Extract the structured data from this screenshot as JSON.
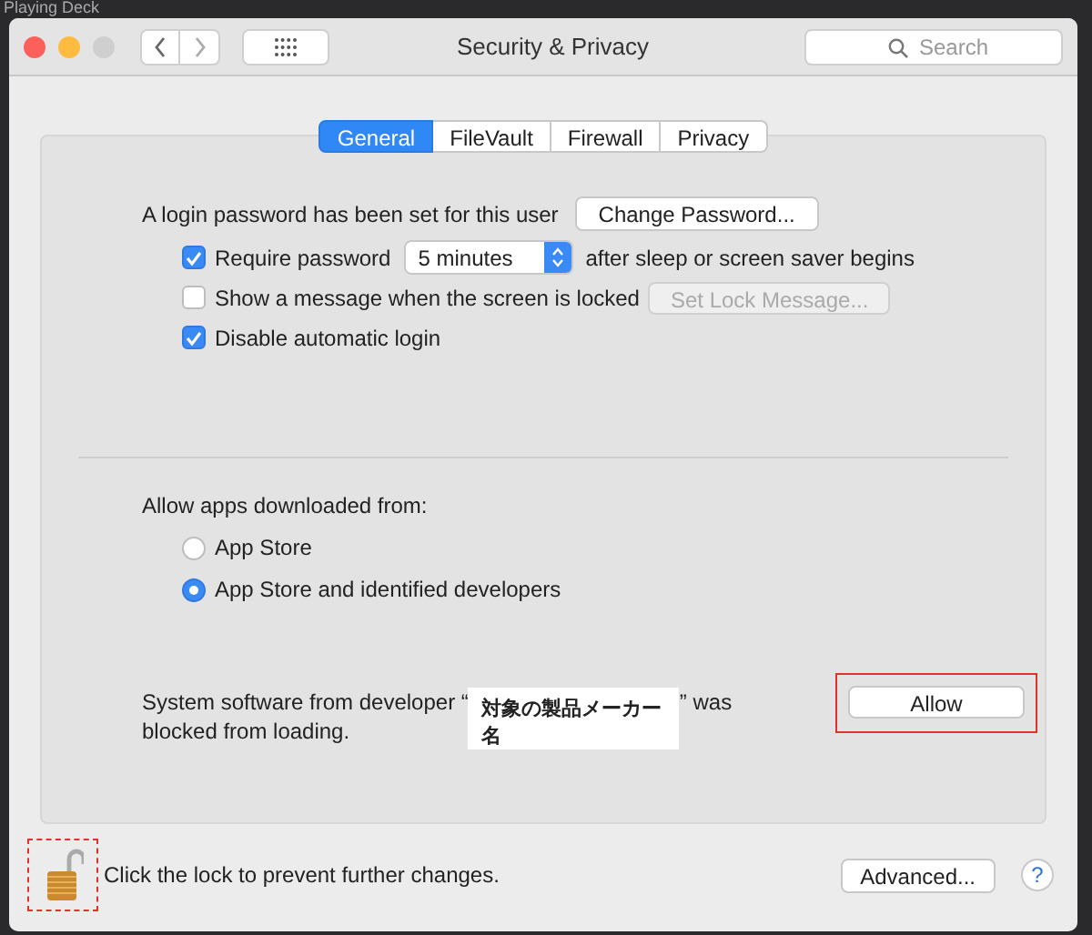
{
  "background_text": "Playing Deck",
  "window": {
    "title": "Security & Privacy",
    "search": {
      "placeholder": "Search"
    }
  },
  "tabs": [
    {
      "label": "General",
      "selected": true
    },
    {
      "label": "FileVault",
      "selected": false
    },
    {
      "label": "Firewall",
      "selected": false
    },
    {
      "label": "Privacy",
      "selected": false
    }
  ],
  "login": {
    "text": "A login password has been set for this user",
    "button": "Change Password..."
  },
  "options": [
    {
      "kind": "select",
      "label": "Require password",
      "checked": true,
      "value": "5 minutes",
      "after": "after sleep or screen saver begins"
    },
    {
      "kind": "button",
      "label": "Show a message when the screen is locked",
      "checked": false,
      "button": "Set Lock Message...",
      "disabled": true
    },
    {
      "kind": "plain",
      "label": "Disable automatic login",
      "checked": true
    }
  ],
  "downloads": {
    "heading": "Allow apps downloaded from:",
    "choices": [
      {
        "label": "App Store",
        "selected": false
      },
      {
        "label": "App Store and identified developers",
        "selected": true
      }
    ]
  },
  "blocked": {
    "before": "System software from developer “",
    "developer": "対象の製品メーカー名",
    "after": "” was",
    "line2": "blocked from loading.",
    "button": "Allow",
    "highlighted": true
  },
  "footer": {
    "lock_text": "Click the lock to prevent further changes.",
    "lock_highlighted": true,
    "advanced": "Advanced...",
    "help": "?"
  }
}
